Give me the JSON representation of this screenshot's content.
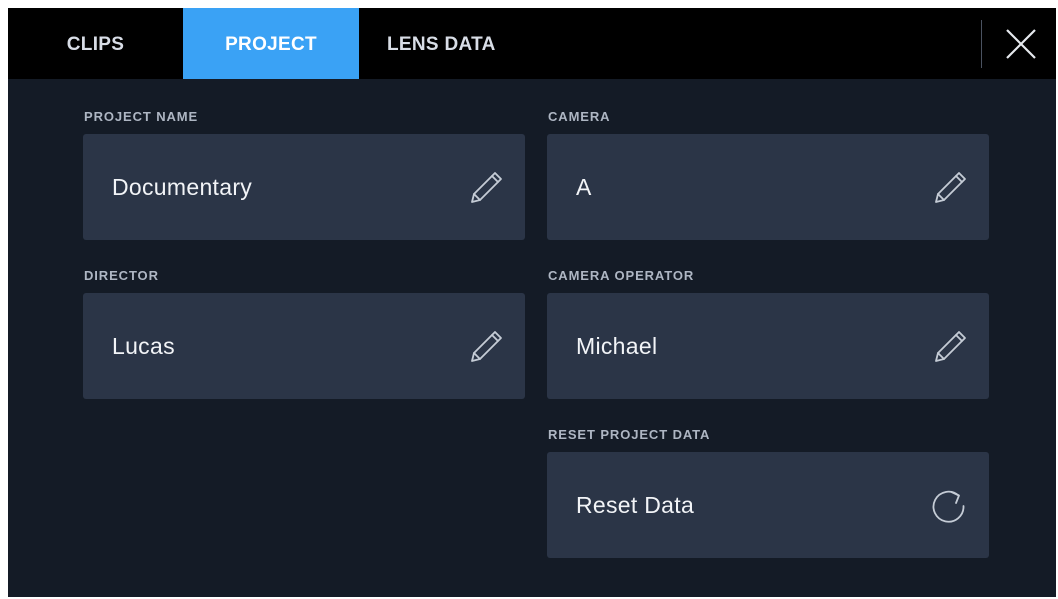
{
  "tabs": {
    "clips": "CLIPS",
    "project": "PROJECT",
    "lens_data": "LENS DATA",
    "active": "PROJECT"
  },
  "close_icon": "close-icon",
  "fields": {
    "project_name": {
      "label": "PROJECT NAME",
      "value": "Documentary",
      "icon": "pencil-icon"
    },
    "camera": {
      "label": "CAMERA",
      "value": "A",
      "icon": "pencil-icon"
    },
    "director": {
      "label": "DIRECTOR",
      "value": "Lucas",
      "icon": "pencil-icon"
    },
    "camera_operator": {
      "label": "CAMERA OPERATOR",
      "value": "Michael",
      "icon": "pencil-icon"
    },
    "reset_project_data": {
      "label": "RESET PROJECT DATA",
      "value": "Reset Data",
      "icon": "reset-icon"
    }
  },
  "colors": {
    "background": "#141b26",
    "tab_bar": "#000000",
    "active_tab": "#3aa2f5",
    "field_box": "#2b3547",
    "label_text": "#aeb6c3",
    "value_text": "#f2f4f7"
  }
}
